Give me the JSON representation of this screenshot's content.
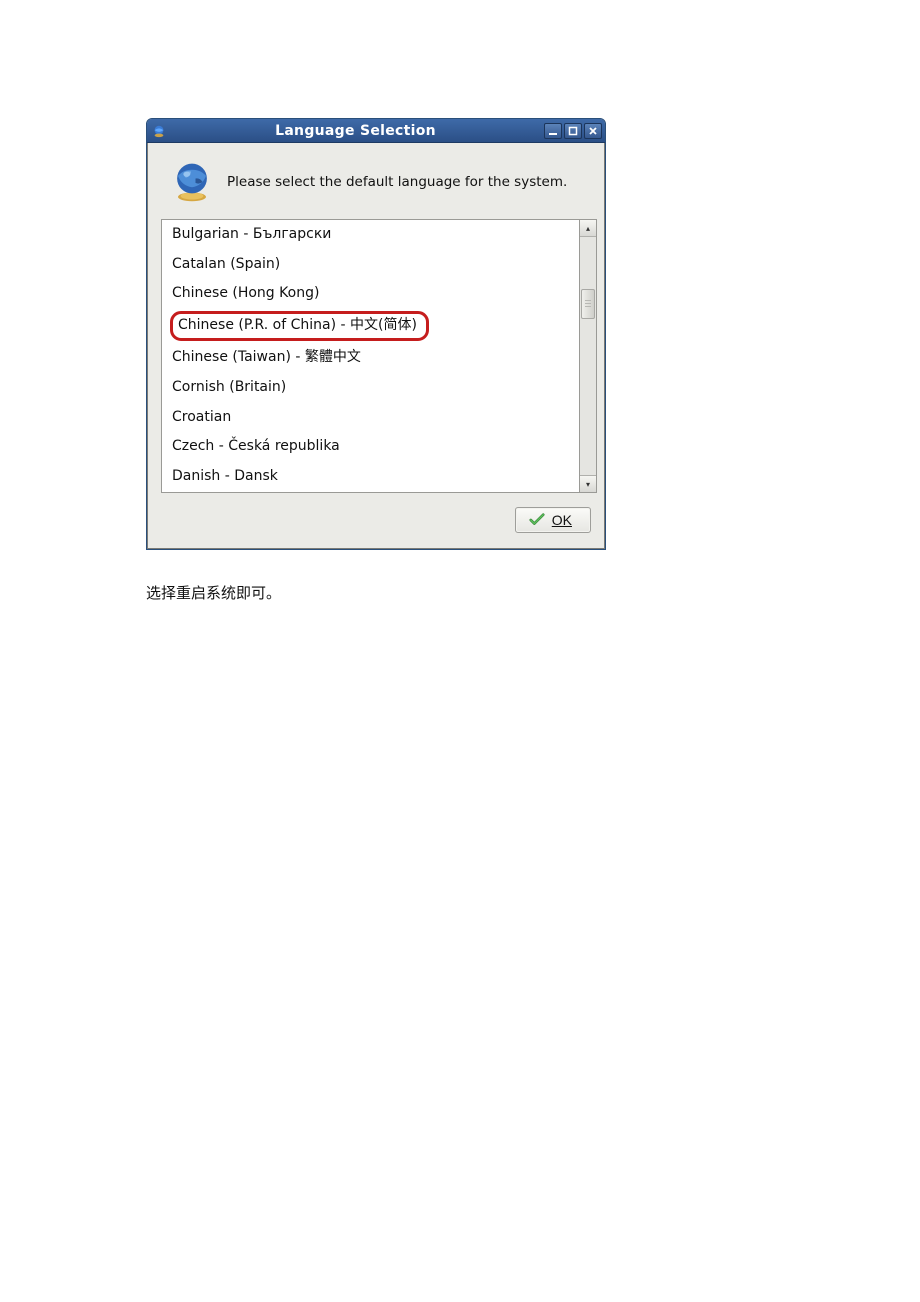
{
  "window": {
    "title": "Language Selection"
  },
  "header": {
    "prompt": "Please select the default language for the system."
  },
  "languages": [
    "Bulgarian - Български",
    "Catalan (Spain)",
    "Chinese (Hong Kong)",
    "Chinese (P.R. of China) - 中文(简体)",
    "Chinese (Taiwan) - 繁體中文",
    "Cornish (Britain)",
    "Croatian",
    "Czech - Česká republika",
    "Danish - Dansk"
  ],
  "highlighted_index": 3,
  "footer": {
    "ok_label": "OK"
  },
  "caption": "选择重启系统即可。"
}
